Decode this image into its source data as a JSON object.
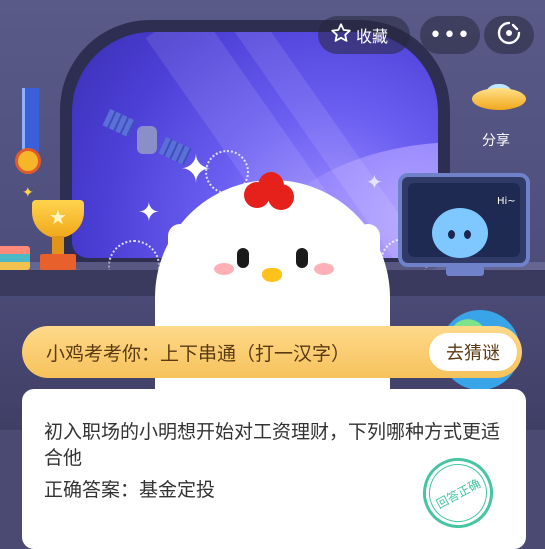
{
  "topbar": {
    "favorite_label": "收藏",
    "favorite_icon": "star-outline-icon",
    "more_label": "•••",
    "more_icon": "more-dots-icon",
    "close_icon": "target-close-icon",
    "share_label": "分享",
    "share_icon": "ufo-icon"
  },
  "scene": {
    "monitor_text": "Hi~"
  },
  "riddle": {
    "text": "小鸡考考你：上下串通（打一汉字）",
    "guess_button": "去猜谜"
  },
  "card": {
    "question": "初入职场的小明想开始对工资理财，下列哪种方式更适合他",
    "answer": "正确答案：基金定投",
    "stamp_text": "回答正确"
  },
  "colors": {
    "accent_yellow": "#f6c25c",
    "stamp_green": "#47c5a2",
    "comb_red": "#e6201a"
  }
}
